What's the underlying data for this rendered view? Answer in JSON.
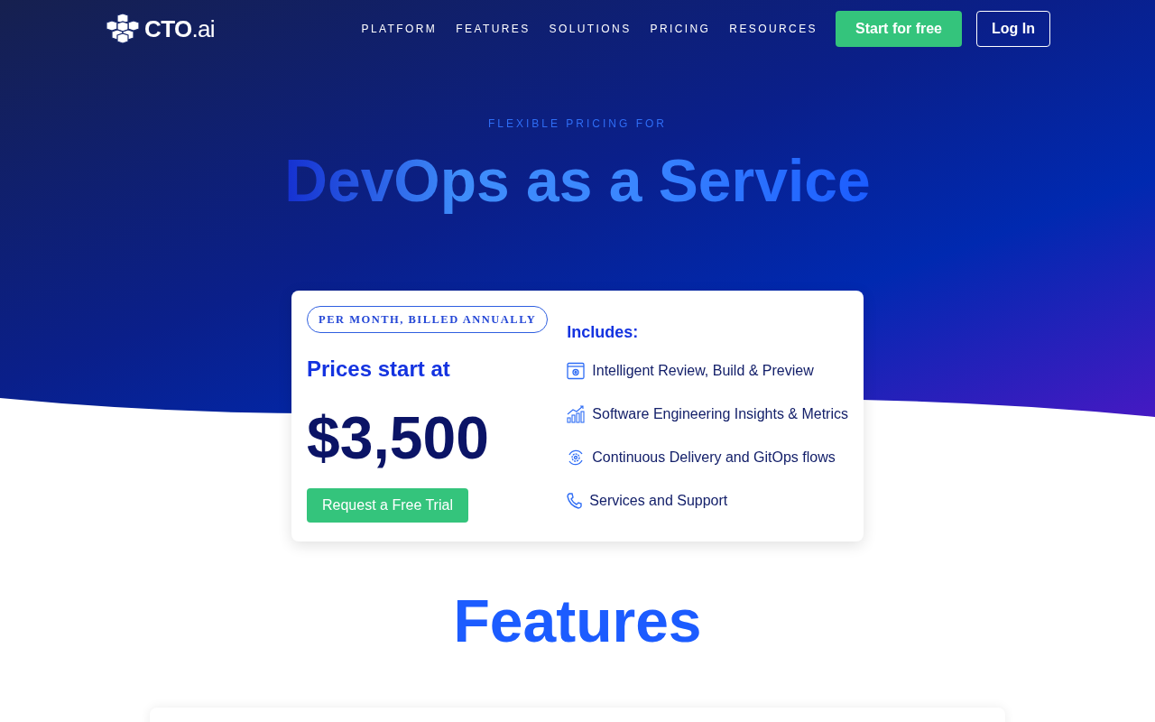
{
  "header": {
    "logo": {
      "text": "CTO",
      "suffix": ".ai"
    },
    "nav": [
      "PLATFORM",
      "FEATURES",
      "SOLUTIONS",
      "PRICING",
      "RESOURCES"
    ],
    "buttons": [
      {
        "label": "Start for free",
        "kind": "primary"
      },
      {
        "label": "Log In",
        "kind": "outline"
      }
    ]
  },
  "hero": {
    "eyebrow": "FLEXIBLE PRICING FOR",
    "title": "DevOps as a Service"
  },
  "pricing_card": {
    "badge": "PER MONTH, BILLED ANNUALLY",
    "heading": "Prices start at",
    "price": "$3,500",
    "button": "Request a Free Trial",
    "includes_title": "Includes:",
    "includes": [
      {
        "kind": "review",
        "label": "Intelligent Review, Build & Preview"
      },
      {
        "kind": "chart",
        "label": "Software Engineering Insights & Metrics"
      },
      {
        "kind": "gear",
        "label": "Continuous Delivery and GitOps flows"
      },
      {
        "kind": "phone",
        "label": "Services and Support"
      }
    ]
  },
  "features": {
    "title": "Features"
  }
}
